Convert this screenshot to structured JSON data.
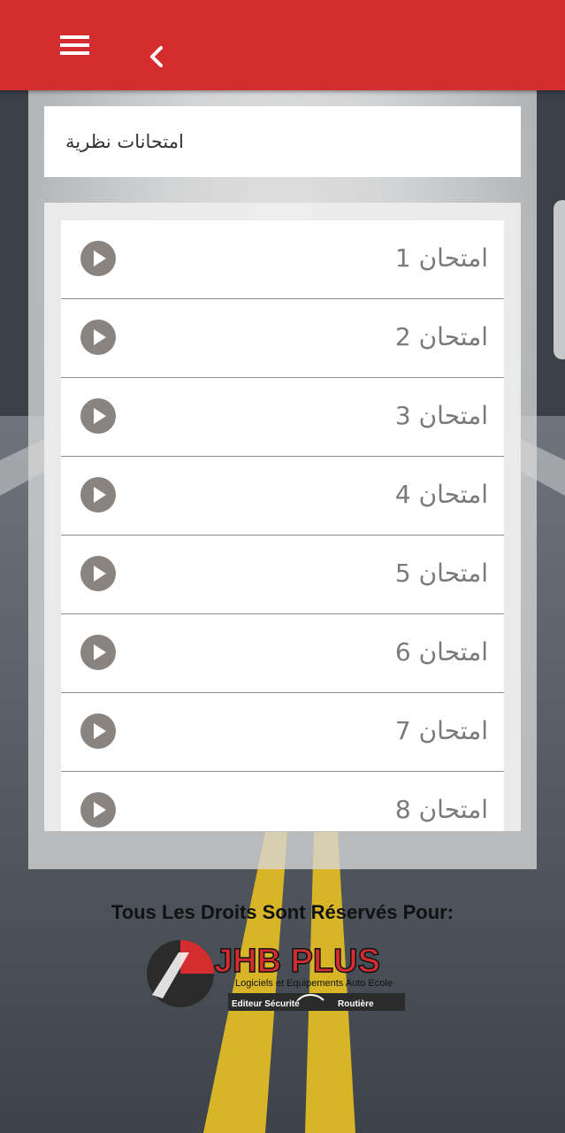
{
  "header": {
    "menu_icon": "hamburger-menu-icon",
    "back_icon": "chevron-left-icon",
    "bg_color": "#d42d2f"
  },
  "page": {
    "title": "امتحانات نظرية"
  },
  "exams": [
    {
      "label": "امتحان 1",
      "icon": "play-circle-icon"
    },
    {
      "label": "امتحان 2",
      "icon": "play-circle-icon"
    },
    {
      "label": "امتحان 3",
      "icon": "play-circle-icon"
    },
    {
      "label": "امتحان 4",
      "icon": "play-circle-icon"
    },
    {
      "label": "امتحان 5",
      "icon": "play-circle-icon"
    },
    {
      "label": "امتحان 6",
      "icon": "play-circle-icon"
    },
    {
      "label": "امتحان 7",
      "icon": "play-circle-icon"
    },
    {
      "label": "امتحان 8",
      "icon": "play-circle-icon"
    }
  ],
  "footer": {
    "copyright": "Tous Les Droits Sont Réservés Pour:",
    "logo": {
      "brand": "JHB PLUS",
      "tagline": "Logiciels et Equipements Auto Ecole",
      "sub_left": "Editeur Sécurité",
      "sub_right": "Routière"
    }
  }
}
